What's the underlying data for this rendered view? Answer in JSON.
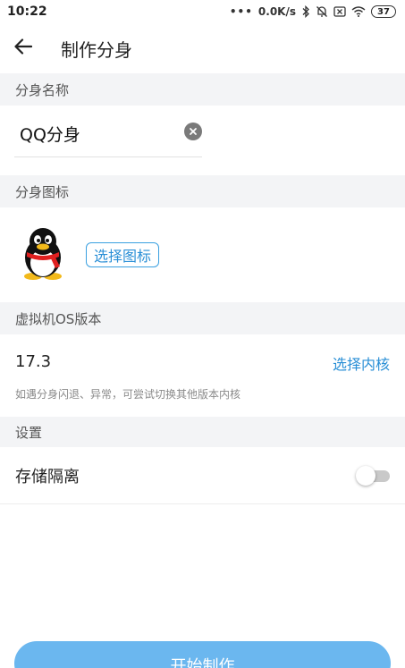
{
  "status_bar": {
    "time": "10:22",
    "speed": "0.0K/s",
    "battery": "37",
    "icons": [
      "dots-icon",
      "bluetooth-icon",
      "mute-bell-icon",
      "sim-off-icon",
      "wifi-icon",
      "battery-icon"
    ]
  },
  "header": {
    "title": "制作分身",
    "back_icon": "arrow-left-icon"
  },
  "sections": {
    "name": "分身名称",
    "icon": "分身图标",
    "os": "虚拟机OS版本",
    "settings": "设置"
  },
  "name_field": {
    "value": "QQ分身",
    "clear_icon": "clear-icon"
  },
  "icon_field": {
    "avatar_icon": "qq-penguin-icon",
    "choose_label": "选择图标"
  },
  "os_field": {
    "version": "17.3",
    "choose_kernel_label": "选择内核",
    "hint": "如遇分身闪退、异常，可尝试切换其他版本内核"
  },
  "settings": {
    "storage_isolation_label": "存储隔离",
    "storage_isolation_on": false
  },
  "footer": {
    "start_label": "开始制作"
  },
  "colors": {
    "accent": "#2a8fd6",
    "button": "#6bb7ef",
    "section_bg": "#f3f4f6"
  }
}
